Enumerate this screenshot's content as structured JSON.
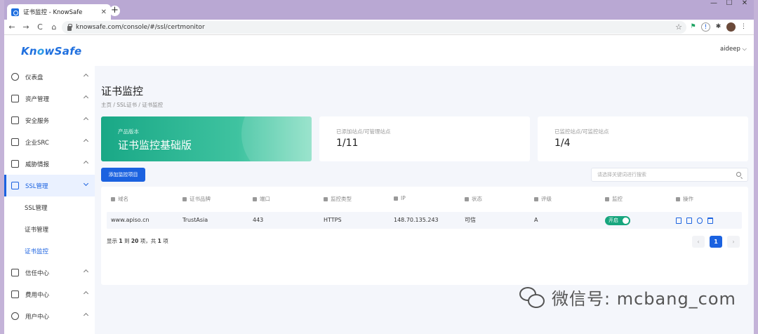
{
  "browser": {
    "tab_title": "证书监控 - KnowSafe",
    "tab_close": "✕",
    "new_tab": "+",
    "url": "knowsafe.com/console/#/ssl/certmonitor",
    "back": "←",
    "forward": "→",
    "reload": "C",
    "home": "⌂",
    "star": "☆",
    "win_min": "—",
    "win_max": "☐",
    "win_close": "✕"
  },
  "app": {
    "logo_pre": "Kn",
    "logo_o": "o",
    "logo_post": "wSafe",
    "user": "aideep ⌵"
  },
  "sidebar": {
    "items": [
      {
        "label": "仪表盘"
      },
      {
        "label": "资产管理"
      },
      {
        "label": "安全服务"
      },
      {
        "label": "企业SRC"
      },
      {
        "label": "威胁情报"
      },
      {
        "label": "SSL管理"
      },
      {
        "label": "信任中心"
      },
      {
        "label": "费用中心"
      },
      {
        "label": "用户中心"
      }
    ],
    "sub_items": [
      {
        "label": "SSL管理"
      },
      {
        "label": "证书管理"
      },
      {
        "label": "证书监控"
      }
    ]
  },
  "page": {
    "title": "证书监控",
    "breadcrumb": "主页 / SSL证书 / 证书监控"
  },
  "cards": {
    "product_label": "产品版本",
    "product_value": "证书监控基础版",
    "sites_label": "已添加站点/可管理站点",
    "sites_value": "1/11",
    "monitor_label": "已监控站点/可监控站点",
    "monitor_value": "1/4"
  },
  "actions": {
    "add_button": "添加监控项目",
    "search_placeholder": "请选择关键词进行搜索"
  },
  "table": {
    "columns": [
      "域名",
      "证书品牌",
      "端口",
      "监控类型",
      "IP",
      "状态",
      "评级",
      "监控",
      "操作"
    ],
    "rows": [
      {
        "domain": "www.apiso.cn",
        "brand": "TrustAsia",
        "port": "443",
        "type": "HTTPS",
        "ip": "148.70.135.243",
        "status": "可信",
        "grade": "A",
        "monitor_label": "开启",
        "monitor_on": true
      }
    ],
    "footer_pre": "显示 ",
    "footer_from": "1",
    "footer_mid1": " 到 ",
    "footer_to": "20",
    "footer_mid2": " 项，共 ",
    "footer_total": "1",
    "footer_post": " 项",
    "page_prev": "‹",
    "page_current": "1",
    "page_next": "›"
  },
  "watermark": {
    "text": "微信号: mcbang_com"
  },
  "colors": {
    "primary": "#1b62e0",
    "green_card": "#19a886",
    "toggle_on": "#17a67e"
  }
}
